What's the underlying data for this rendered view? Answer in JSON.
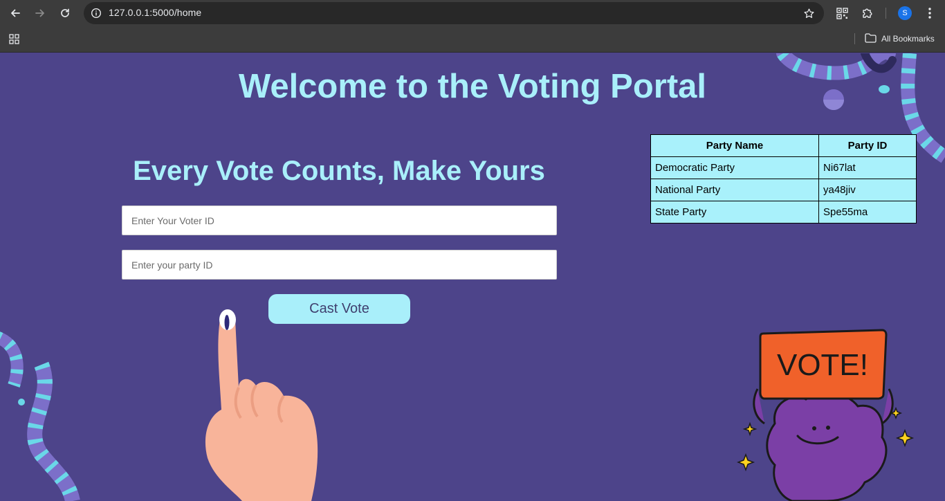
{
  "browser": {
    "url": "127.0.0.1:5000/home",
    "profile_initial": "S",
    "bookmarks_label": "All Bookmarks",
    "icons": {
      "back": "back-arrow-icon",
      "forward": "forward-arrow-icon",
      "reload": "reload-icon",
      "site_info": "site-info-icon",
      "bookmark": "star-icon",
      "qr": "qr-code-icon",
      "extensions": "puzzle-icon",
      "menu": "kebab-menu-icon",
      "apps": "apps-grid-icon",
      "folder": "folder-icon"
    }
  },
  "page": {
    "title": "Welcome to the Voting Portal",
    "subtitle": "Every Vote Counts, Make Yours",
    "voter_id_placeholder": "Enter Your Voter ID",
    "party_id_placeholder": "Enter your party ID",
    "cast_vote_label": "Cast Vote",
    "colors": {
      "background": "#4d448a",
      "accent": "#a9effa",
      "sign": "#f0612a",
      "mascot": "#7b3fa6"
    }
  },
  "party_table": {
    "headers": [
      "Party Name",
      "Party ID"
    ],
    "rows": [
      {
        "name": "Democratic Party",
        "id": "Ni67lat"
      },
      {
        "name": "National Party",
        "id": "ya48jiv"
      },
      {
        "name": "State Party",
        "id": "Spe55ma"
      }
    ]
  },
  "illustrations": {
    "mascot_sign_text": "VOTE!",
    "hand": "voting-hand-ink-illustration",
    "mascot": "vote-mascot-illustration",
    "streamers": "striped-streamer-decoration"
  }
}
